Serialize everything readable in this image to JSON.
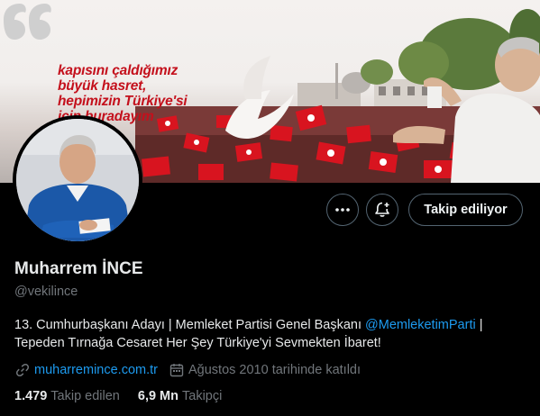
{
  "banner": {
    "lines": [
      "kapısını çaldığımız",
      "büyük hasret,",
      "hepimizin Türkiye'si",
      "için buradayım"
    ]
  },
  "profile": {
    "name": "Muharrem İNCE",
    "handle": "@vekilince",
    "bio_line1_text": "13. Cumhurbaşkanı Adayı | Memleket Partisi Genel Başkanı ",
    "bio_line1_mention": "@MemleketimParti",
    "bio_line1_end": " |",
    "bio_line2": "Tepeden Tırnağa Cesaret Her Şey Türkiye'yi Sevmekten İbaret!",
    "website": "muharremince.com.tr",
    "joined": "Ağustos 2010 tarihinde katıldı"
  },
  "actions": {
    "more_icon": "more-icon",
    "notify_icon": "bell-plus-icon",
    "follow_label": "Takip ediliyor"
  },
  "stats": {
    "following_count": "1.479",
    "following_label": "Takip edilen",
    "followers_count": "6,9 Mn",
    "followers_label": "Takipçi"
  },
  "colors": {
    "background": "#000000",
    "accent": "#1d9bf0",
    "muted": "#71767b",
    "banner_red": "#c4101c"
  }
}
